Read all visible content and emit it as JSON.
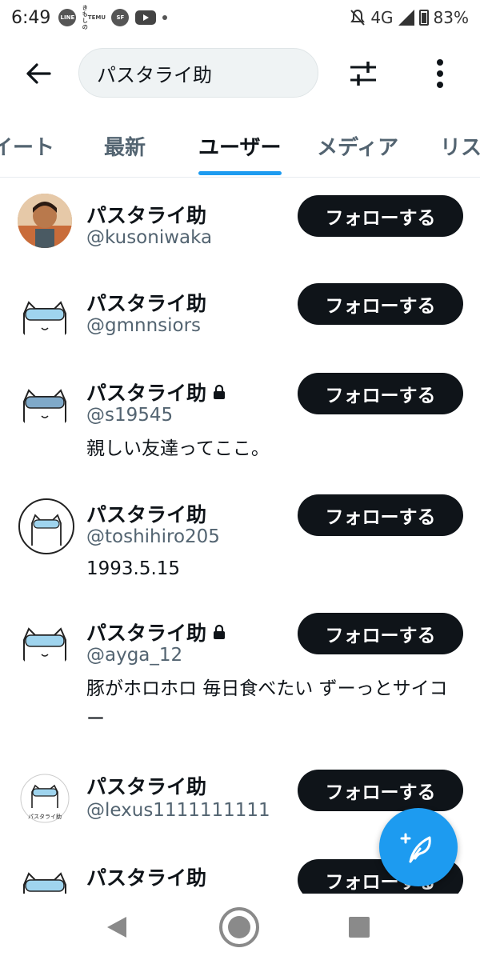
{
  "status": {
    "time": "6:49",
    "app_line": "LINE",
    "app_temu": "TEMU",
    "app_temu_top": "きもしの",
    "app_sf": "SF",
    "network": "4G",
    "battery": "83%"
  },
  "header": {
    "search_value": "パスタライ助"
  },
  "tabs": [
    {
      "label": "イート"
    },
    {
      "label": "最新"
    },
    {
      "label": "ユーザー"
    },
    {
      "label": "メディア"
    },
    {
      "label": "リス"
    }
  ],
  "users": [
    {
      "name": "パスタライ助",
      "handle": "@kusoniwaka",
      "bio": "",
      "locked": false,
      "follow": "フォローする"
    },
    {
      "name": "パスタライ助",
      "handle": "@gmnnsiors",
      "bio": "",
      "locked": false,
      "follow": "フォローする"
    },
    {
      "name": "パスタライ助",
      "handle": "@s19545",
      "bio": "親しい友達ってここ。",
      "locked": true,
      "follow": "フォローする"
    },
    {
      "name": "パスタライ助",
      "handle": "@toshihiro205",
      "bio": "1993.5.15",
      "locked": false,
      "follow": "フォローする"
    },
    {
      "name": "パスタライ助",
      "handle": "@ayga_12",
      "bio": "豚がホロホロ 毎日食べたい ずーっとサイコー",
      "locked": true,
      "follow": "フォローする"
    },
    {
      "name": "パスタライ助",
      "handle": "@lexus1111111111",
      "bio": "",
      "locked": false,
      "follow": "フォローする",
      "avatar_text": "パスタライ助"
    },
    {
      "name": "パスタライ助",
      "handle": "",
      "bio": "",
      "locked": false,
      "follow": "フォローする"
    }
  ],
  "colors": {
    "accent": "#1d9bf0",
    "button": "#0f1419",
    "secondary_text": "#536471"
  }
}
